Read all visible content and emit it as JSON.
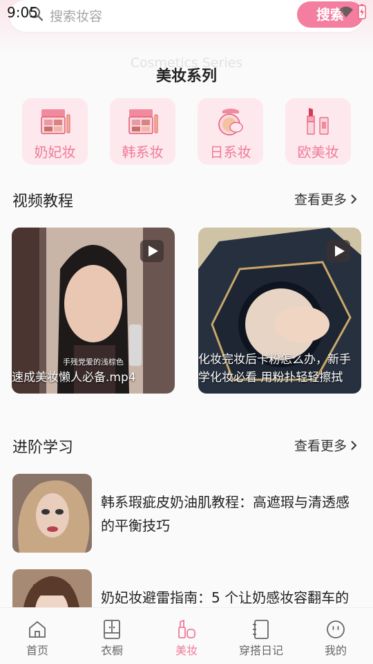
{
  "status_bar": {
    "time": "9:05"
  },
  "search": {
    "placeholder": "搜索妆容",
    "button_label": "搜索"
  },
  "makeup_series": {
    "subtitle_en": "Cosmetics Series",
    "title": "美妆系列",
    "categories": [
      {
        "label": "奶妃妆",
        "icon": "eyeshadow-palette-icon"
      },
      {
        "label": "韩系妆",
        "icon": "eyeshadow-palette-icon"
      },
      {
        "label": "日系妆",
        "icon": "cushion-compact-icon"
      },
      {
        "label": "欧美妆",
        "icon": "lipstick-icon"
      }
    ]
  },
  "video_tutorials": {
    "title": "视频教程",
    "more_label": "查看更多",
    "videos": [
      {
        "title": "速成美妆懒人必备.mp4",
        "subtitle": "手残党爱的浅棕色"
      },
      {
        "title": "化妆完妆后卡粉怎么办，新手学化妆必看 用粉扑轻轻擦拭"
      }
    ]
  },
  "advanced_learning": {
    "title": "进阶学习",
    "more_label": "查看更多",
    "articles": [
      {
        "title": "韩系瑕疵皮奶油肌教程：高遮瑕与清透感的平衡技巧"
      },
      {
        "title": "奶妃妆避雷指南：5 个让奶感妆容翻车的"
      }
    ]
  },
  "tab_bar": {
    "active_color": "#f07a9a",
    "tabs": [
      {
        "label": "首页",
        "icon": "home-icon"
      },
      {
        "label": "衣橱",
        "icon": "wardrobe-icon"
      },
      {
        "label": "美妆",
        "icon": "makeup-icon",
        "active": true
      },
      {
        "label": "穿搭日记",
        "icon": "diary-icon"
      },
      {
        "label": "我的",
        "icon": "profile-icon"
      }
    ]
  },
  "colors": {
    "accent": "#f47ea0",
    "category_bg": "#fde8ee"
  }
}
